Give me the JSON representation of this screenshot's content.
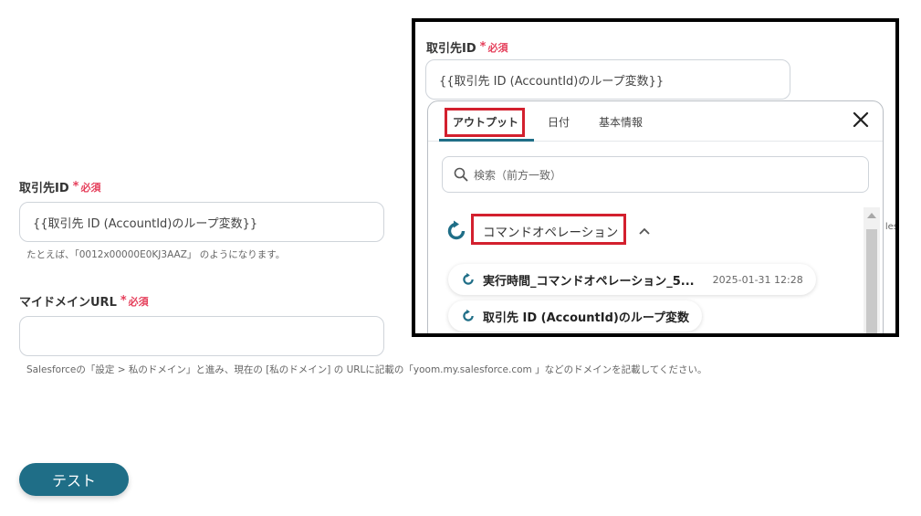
{
  "form": {
    "account_id_label": "取引先ID",
    "required_text": "必須",
    "account_id_value": "{{取引先 ID (AccountId)のループ変数}}",
    "account_id_hint": "たとえば、「0012x00000E0KJ3AAZ」 のようになります。",
    "domain_label": "マイドメインURL",
    "domain_value": "",
    "domain_hint": "Salesforceの「設定 > 私のドメイン」と進み、現在の [私のドメイン] の URLに記載の「yoom.my.salesforce.com 」などのドメインを記載してください。",
    "test_button": "テスト"
  },
  "zoom": {
    "label": "取引先ID",
    "required_text": "必須",
    "field_value": "{{取引先 ID (AccountId)のループ変数}}",
    "tabs": [
      "アウトプット",
      "日付",
      "基本情報"
    ],
    "search_placeholder": "検索（前方一致）",
    "group_label": "コマンドオペレーション",
    "items": [
      {
        "label": "実行時間_コマンドオペレーション_5...",
        "date": "2025-01-31 12:28"
      },
      {
        "label": "取引先 ID (AccountId)のループ変数",
        "date": ""
      }
    ],
    "edge_text": "les"
  },
  "colors": {
    "accent": "#1f6e87",
    "required": "#e53e5a",
    "highlight": "#d3202e"
  }
}
